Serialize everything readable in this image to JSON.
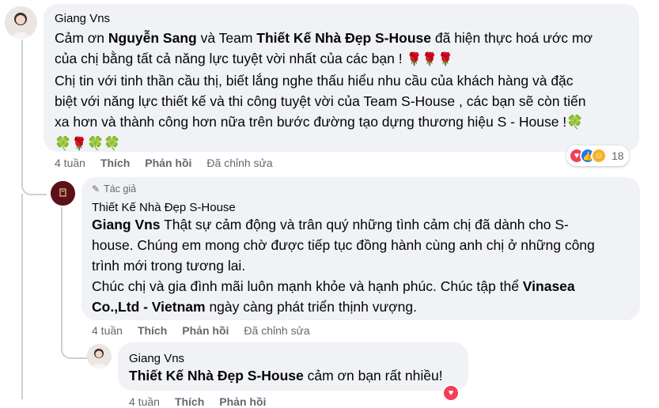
{
  "comment1": {
    "author": "Giang Vns",
    "lines": [
      [
        "Cảm ơn ",
        "Nguyễn Sang",
        " và Team ",
        "Thiết Kế Nhà Đẹp S-House",
        " đã hiện thực hoá ước mơ"
      ],
      "của chị bằng tất cả năng lực tuyệt vời nhất của các bạn ! ",
      "Chị tin với tinh thần cầu thị, biết lắng nghe thấu hiểu nhu cầu của khách hàng và đặc",
      "biệt với năng lực thiết kế và thi công tuyệt vời của Team S-House , các bạn sẽ còn tiến",
      "xa hơn và thành công hơn nữa trên bước đường tạo dựng thương hiệu S - House !"
    ],
    "time": "4 tuần",
    "like": "Thích",
    "reply": "Phản hồi",
    "edited": "Đã chỉnh sửa",
    "reaction_count": "18"
  },
  "comment2": {
    "badge": "Tác giả",
    "author": "Thiết Kế Nhà Đẹp S-House",
    "mention": "Giang Vns",
    "line1_rest": " Thật sự cảm động và trân quý những tình cảm chị đã dành cho S-",
    "line2": "house. Chúng em mong chờ được tiếp tục đồng hành cùng anh chị ở những công",
    "line3": "trình mới trong tương lai.",
    "line4_a": "Chúc chị và gia đình mãi luôn mạnh khỏe và hạnh phúc. Chúc tập thể ",
    "line4_mention": "Vinasea",
    "line5_mention": "Co.,Ltd - Vietnam",
    "line5_rest": " ngày càng phát triển thịnh vượng.",
    "time": "4 tuần",
    "like": "Thích",
    "reply": "Phản hồi",
    "edited": "Đã chỉnh sửa"
  },
  "comment3": {
    "author": "Giang Vns",
    "mention": "Thiết Kế Nhà Đẹp S-House",
    "rest": " cảm ơn bạn rất nhiều!",
    "time": "4 tuần",
    "like": "Thích",
    "reply": "Phản hồi"
  },
  "icons": {
    "rose": "rose-icon",
    "clover": "four-leaf-clover-icon",
    "pencil": "pencil-icon",
    "love": "love-reaction-icon",
    "like": "like-reaction-icon",
    "care": "care-reaction-icon"
  },
  "colors": {
    "bubble": "#f0f2f5",
    "love": "#f33e58",
    "like": "#1877f2",
    "care": "#f7b125",
    "secondary_text": "#65676b"
  }
}
